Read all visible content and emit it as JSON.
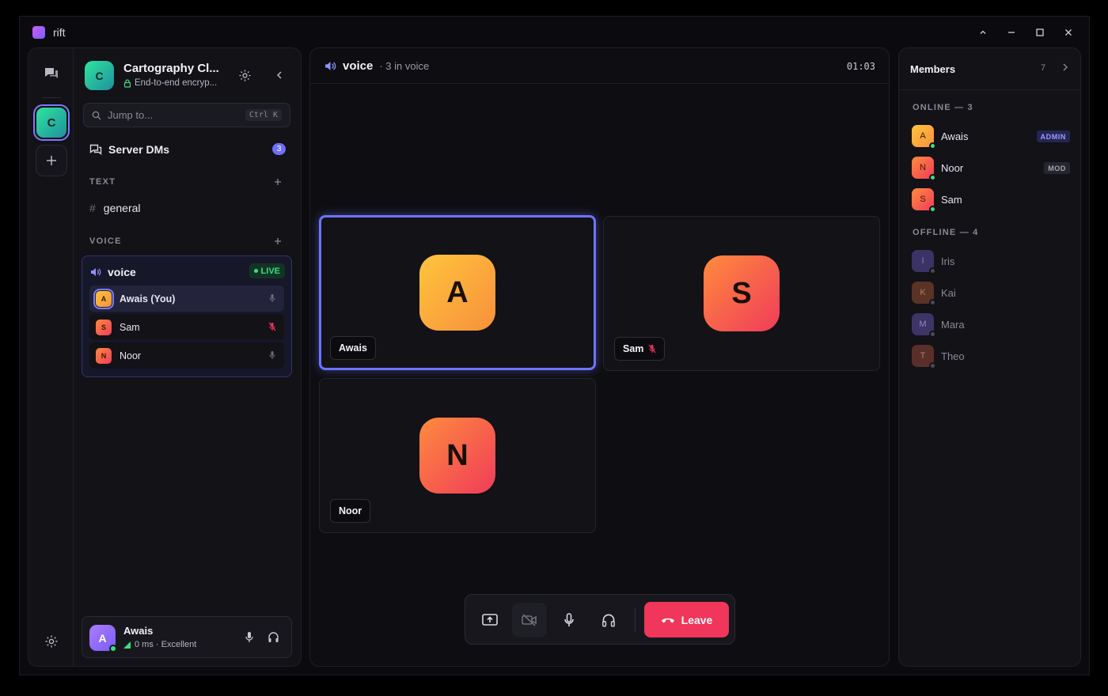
{
  "app": {
    "name": "rift"
  },
  "server": {
    "name": "Cartography Cl...",
    "initial": "C",
    "encryption": "End-to-end encryp..."
  },
  "search": {
    "placeholder": "Jump to...",
    "shortcut": "Ctrl K"
  },
  "sidebar": {
    "dm_label": "Server DMs",
    "dm_badge": "3",
    "text_section": "TEXT",
    "voice_section": "VOICE",
    "text_channels": [
      {
        "name": "general"
      }
    ],
    "voice_channel": {
      "name": "voice",
      "live_label": "LIVE",
      "users": [
        {
          "name": "Awais (You)",
          "initial": "A",
          "muted": false
        },
        {
          "name": "Sam",
          "initial": "S",
          "muted": true
        },
        {
          "name": "Noor",
          "initial": "N",
          "muted": false
        }
      ]
    }
  },
  "self": {
    "name": "Awais",
    "initial": "A",
    "status": "0 ms · Excellent"
  },
  "call": {
    "channel": "voice",
    "subtitle": "· 3 in voice",
    "timer": "01:03",
    "tiles": [
      {
        "name": "Awais",
        "initial": "A",
        "speaking": true,
        "muted": false
      },
      {
        "name": "Sam",
        "initial": "S",
        "speaking": false,
        "muted": true
      },
      {
        "name": "Noor",
        "initial": "N",
        "speaking": false,
        "muted": false
      }
    ],
    "leave_label": "Leave"
  },
  "members": {
    "title": "Members",
    "count": "7",
    "online_label": "ONLINE — 3",
    "offline_label": "OFFLINE — 4",
    "online": [
      {
        "name": "Awais",
        "initial": "A",
        "role": "ADMIN"
      },
      {
        "name": "Noor",
        "initial": "N",
        "role": "MOD"
      },
      {
        "name": "Sam",
        "initial": "S",
        "role": ""
      }
    ],
    "offline": [
      {
        "name": "Iris",
        "initial": "I"
      },
      {
        "name": "Kai",
        "initial": "K"
      },
      {
        "name": "Mara",
        "initial": "M"
      },
      {
        "name": "Theo",
        "initial": "T"
      }
    ]
  },
  "colors": {
    "accent": "#6f73ff",
    "live": "#3ddc84",
    "leave": "#f0365a",
    "muted": "#f0365a"
  }
}
